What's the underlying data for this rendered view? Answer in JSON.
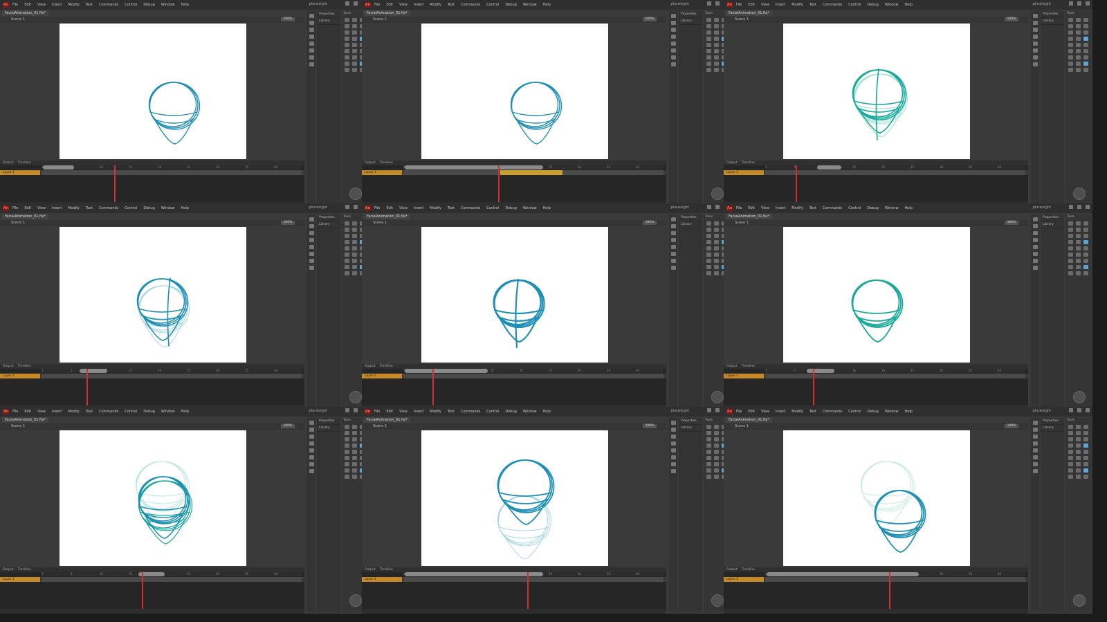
{
  "app": {
    "logo": "An",
    "menu": [
      "File",
      "Edit",
      "View",
      "Insert",
      "Modify",
      "Text",
      "Commands",
      "Control",
      "Debug",
      "Window",
      "Help"
    ],
    "workspace": "pluralsight",
    "document_tab": "FacialAnimation_01.fla*",
    "scene": "Scene 1",
    "zoom": "100%",
    "panels": [
      "Properties",
      "Library"
    ],
    "tools_label": "Tools",
    "timeline_tabs": [
      "Output",
      "Timeline"
    ],
    "layer_name": "Layer 1",
    "ruler_ticks": [
      "1",
      "5",
      "10",
      "15",
      "20",
      "25",
      "30",
      "35",
      "40"
    ],
    "colors": {
      "accent": "#c48a2a",
      "stroke_primary": "#1f8fb5",
      "stroke_teal": "#17a99a",
      "onion": "#8a8a8a",
      "playhead": "#d03030"
    }
  },
  "frames": [
    {
      "id": 1,
      "sketch": "head-front-down"
    },
    {
      "id": 2,
      "sketch": "head-front-down"
    },
    {
      "id": 3,
      "sketch": "head-turn-onion"
    },
    {
      "id": 4,
      "sketch": "head-turn-left"
    },
    {
      "id": 5,
      "sketch": "head-front-bold"
    },
    {
      "id": 6,
      "sketch": "head-front-teal"
    },
    {
      "id": 7,
      "sketch": "head-tilt-onion"
    },
    {
      "id": 8,
      "sketch": "head-up-onion"
    },
    {
      "id": 9,
      "sketch": "head-down-onion"
    }
  ]
}
